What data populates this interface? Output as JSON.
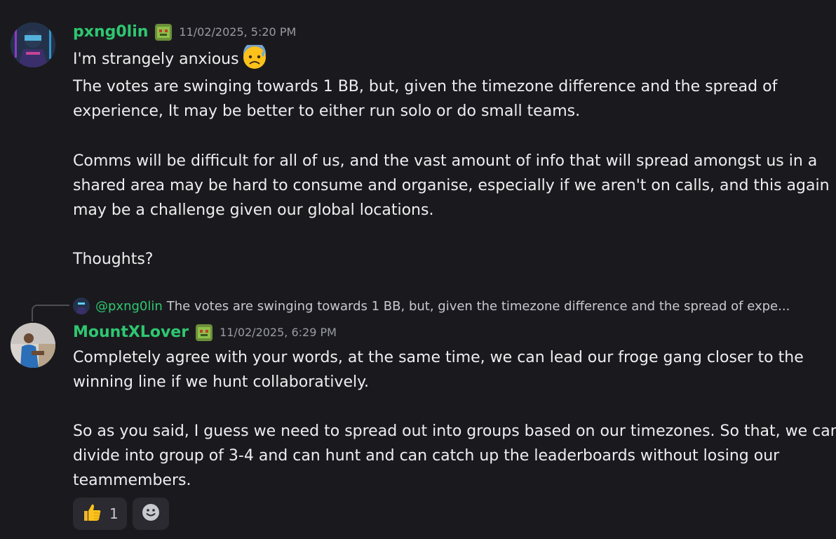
{
  "messages": [
    {
      "username": "pxng0lin",
      "timestamp": "11/02/2025, 5:20 PM",
      "lines": [
        "I'm strangely anxious",
        "The votes are swinging towards 1 BB, but, given the timezone difference and the spread of",
        "experience, It may be better to either run solo or do small teams.",
        "Comms will be difficult for all of us, and the vast amount of info that will spread amongst us in a",
        "shared area may be hard to consume and organise, especially if we aren't on calls, and this again",
        "may be a challenge given our global locations.",
        "Thoughts?"
      ],
      "inline_emoji": "anxious-face-with-sweat-icon"
    },
    {
      "reply": {
        "mention": "@pxng0lin",
        "preview": "The votes are swinging towards 1 BB, but, given the timezone difference and the spread of expe..."
      },
      "username": "MountXLover",
      "timestamp": "11/02/2025, 6:29 PM",
      "lines": [
        "Completely agree with your words, at the same time, we can lead our froge gang closer to the",
        "winning line if we hunt collaboratively.",
        "So as you said, I guess we need to spread out into groups based on our timezones. So that, we can",
        "divide into group of 3-4 and can hunt and can catch up the leaderboards without losing our",
        "teammembers."
      ],
      "reactions": [
        {
          "emoji": "thumbs-up-icon",
          "count": "1"
        }
      ]
    }
  ],
  "colors": {
    "background": "#1a1a1e",
    "username": "#2fc771",
    "text": "#eeeef0",
    "timestamp": "#9a9aa3",
    "reaction_bg": "#2a2a30"
  }
}
